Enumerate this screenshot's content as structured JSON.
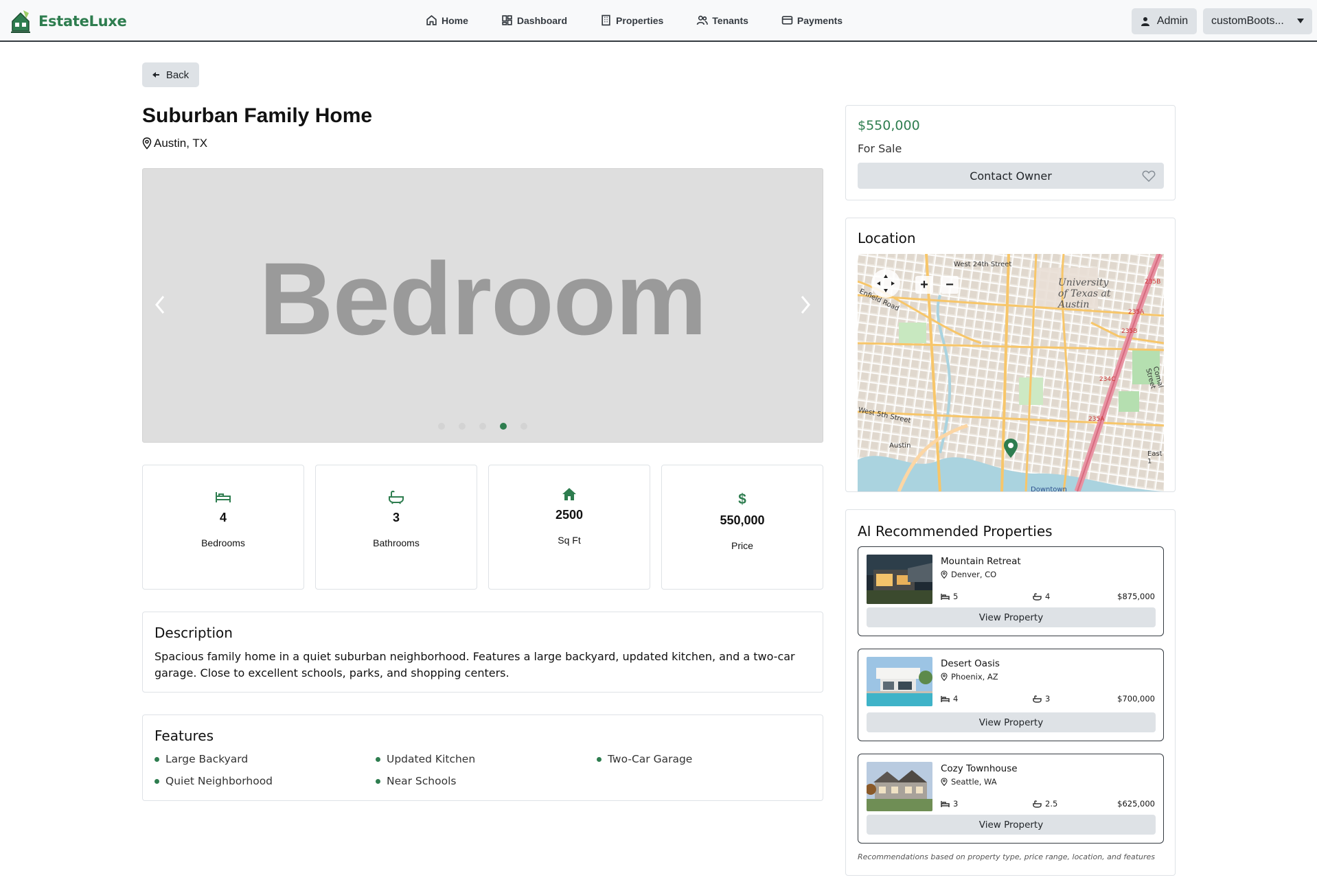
{
  "navbar": {
    "brand": "EstateLuxe",
    "links": [
      "Home",
      "Dashboard",
      "Properties",
      "Tenants",
      "Payments"
    ],
    "admin_label": "Admin",
    "user_select_value": "customBoots..."
  },
  "back_label": "Back",
  "property": {
    "title": "Suburban Family Home",
    "location": "Austin, TX",
    "carousel_text": "Bedroom",
    "carousel_slides": 5,
    "carousel_active_index": 3,
    "stats": [
      {
        "icon": "bed-icon",
        "value": "4",
        "label": "Bedrooms"
      },
      {
        "icon": "bath-icon",
        "value": "3",
        "label": "Bathrooms"
      },
      {
        "icon": "home-icon",
        "value": "2500",
        "label": "Sq Ft"
      },
      {
        "icon": "dollar-icon",
        "value": "550,000",
        "label": "Price"
      }
    ],
    "description_title": "Description",
    "description": "Spacious family home in a quiet suburban neighborhood. Features a large backyard, updated kitchen, and a two-car garage. Close to excellent schools, parks, and shopping centers.",
    "features_title": "Features",
    "features": [
      "Large Backyard",
      "Updated Kitchen",
      "Two-Car Garage",
      "Quiet Neighborhood",
      "Near Schools"
    ]
  },
  "sidebar": {
    "price": "$550,000",
    "status": "For Sale",
    "contact_label": "Contact Owner",
    "location_title": "Location",
    "map_labels": {
      "west_24th": "West 24th Street",
      "university": "University of Texas at Austin",
      "enfield": "Enfield Road",
      "fifth": "West 5th Street",
      "austin": "Austin",
      "downtown": "Downtown",
      "comal": "Comal Street",
      "east": "East 1",
      "r235b_1": "235B",
      "r235a_1": "235A",
      "r235b_2": "235B",
      "r234c": "234C",
      "r235a_2": "235A"
    },
    "rec_title": "AI Recommended Properties",
    "recommendations": [
      {
        "name": "Mountain Retreat",
        "location": "Denver, CO",
        "beds": "5",
        "baths": "4",
        "price": "$875,000",
        "button": "View Property"
      },
      {
        "name": "Desert Oasis",
        "location": "Phoenix, AZ",
        "beds": "4",
        "baths": "3",
        "price": "$700,000",
        "button": "View Property"
      },
      {
        "name": "Cozy Townhouse",
        "location": "Seattle, WA",
        "beds": "3",
        "baths": "2.5",
        "price": "$625,000",
        "button": "View Property"
      }
    ],
    "rec_note": "Recommendations based on property type, price range, location, and features"
  },
  "colors": {
    "accent": "#2e7d4f",
    "button_bg": "#dee2e6",
    "navbar_bg": "#f8f9fa"
  }
}
